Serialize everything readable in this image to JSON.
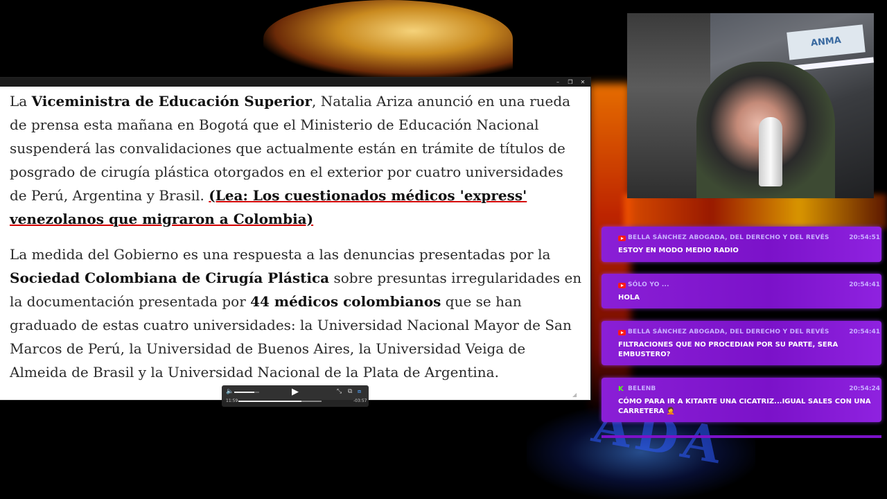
{
  "document": {
    "p1_a": "La ",
    "p1_b": "Viceministra de Educación Superior",
    "p1_c": ", Natalia Ariza anunció en una rueda de prensa esta mañana en Bogotá que el Ministerio de Educación Nacional suspenderá las convalidaciones que actualmente están en trámite de títulos de posgrado de cirugía plástica otorgados en el exterior por cuatro universidades de Perú, Argentina y Brasil. ",
    "p1_link": "(Lea: Los cuestionados médicos 'express' venezolanos que migraron a Colombia)",
    "p2_a": "La medida del Gobierno es una respuesta a las denuncias presentadas por la ",
    "p2_b": "Sociedad Colombiana de Cirugía Plástica",
    "p2_c": " sobre presuntas irregularidades en la documentación presentada por ",
    "p2_d": "44 médicos colombianos",
    "p2_e": " que se han graduado de estas cuatro universidades: la Universidad Nacional Mayor de San Marcos de Perú, la Universidad de Buenos Aires, la Universidad Veiga de Almeida de Brasil y la Universidad Nacional de la Plata de Argentina."
  },
  "player": {
    "time_current": "11:59",
    "time_remaining": "-03:57",
    "progress": 0.76,
    "volume": 0.8,
    "icons": [
      "volume-icon",
      "play-icon",
      "shrink-icon",
      "pip-icon",
      "cc-icon"
    ]
  },
  "webcam": {
    "sign_text": "ANMA"
  },
  "chat": {
    "messages": [
      {
        "platform": "youtube",
        "author": "Bella Sánchez Abogada, Del Derecho y del Revés",
        "time": "20:54:51",
        "text": "Estoy en modo medio radio"
      },
      {
        "platform": "youtube",
        "author": "Sólo Yo ...",
        "time": "20:54:41",
        "text": "Hola"
      },
      {
        "platform": "youtube",
        "author": "Bella Sánchez Abogada, Del Derecho y del Revés",
        "time": "20:54:41",
        "text": "filtraciones que no procedian por su parte, sera embustero?"
      },
      {
        "platform": "kick",
        "author": "Belenb",
        "time": "20:54:24",
        "text": "Cómo para ir a kitarte una cicatriz...igual sales con una carretera 🤦"
      }
    ]
  },
  "colors": {
    "chat_purple": "#7b12c9",
    "link_underline": "#d40000",
    "youtube_red": "#ff1a1a",
    "kick_green": "#53fc18"
  }
}
